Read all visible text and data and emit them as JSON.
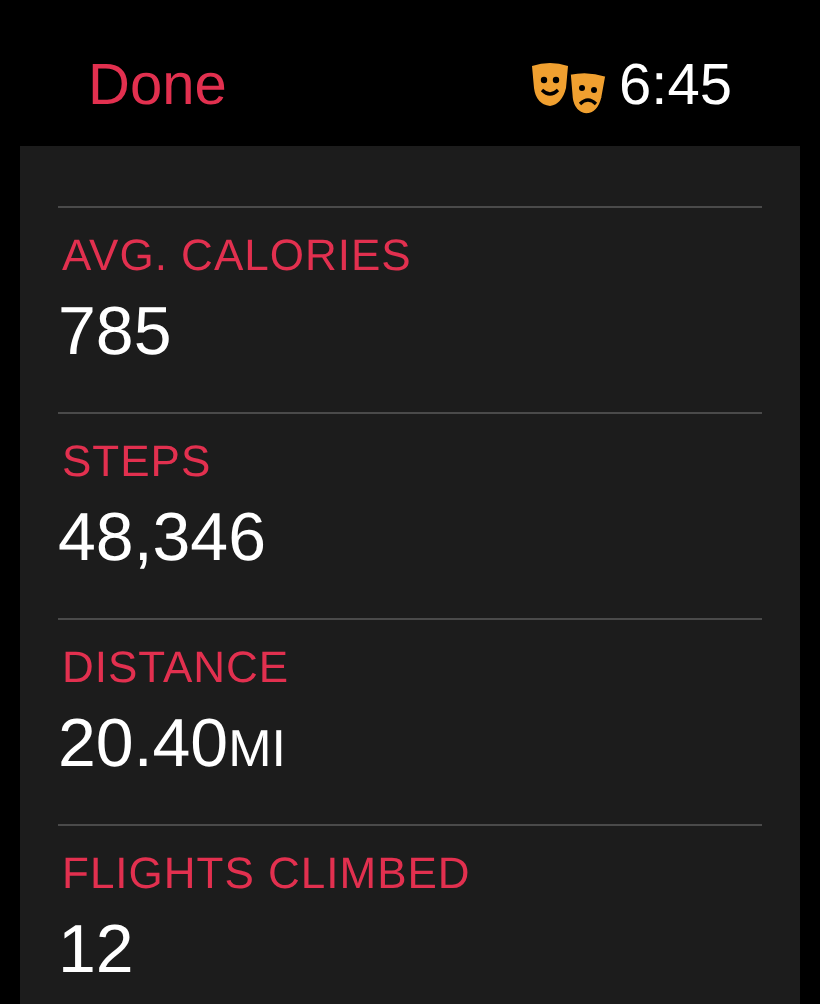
{
  "header": {
    "back_button": "Done",
    "time": "6:45"
  },
  "metrics": [
    {
      "label": "AVG. CALORIES",
      "value": "785"
    },
    {
      "label": "STEPS",
      "value": "48,346"
    },
    {
      "label": "DISTANCE",
      "value": "20.40",
      "unit": "MI"
    },
    {
      "label": "FLIGHTS CLIMBED",
      "value": "12"
    }
  ]
}
